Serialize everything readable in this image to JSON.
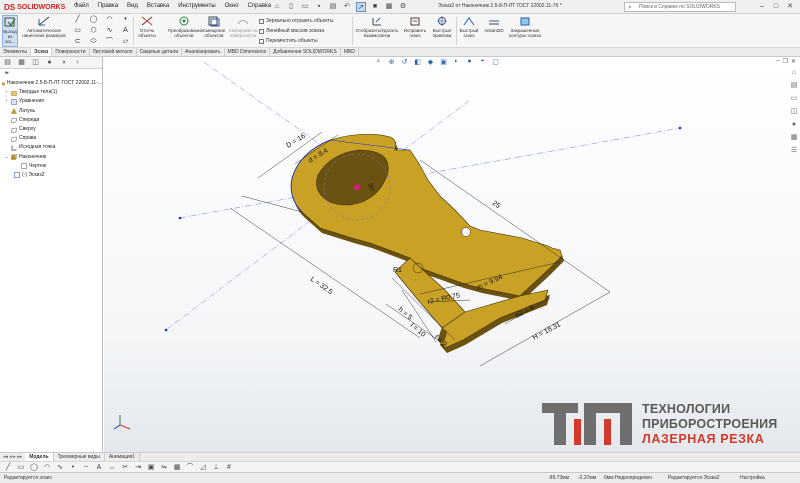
{
  "app": {
    "brand": "SOLIDWORKS",
    "logo_mark": "DS"
  },
  "menu": [
    "Файл",
    "Правка",
    "Вид",
    "Вставка",
    "Инструменты",
    "Окно",
    "Справка"
  ],
  "window": {
    "title": "Эскиз2 от Наконечник 2.5-8-П-ЛТ ГОСТ 22002.11-76 *",
    "search_placeholder": "Поиск в Справке по SOLIDWORKS"
  },
  "ribbon": {
    "exit_sketch": "Выход из эск...",
    "smart_dimension": "Автоматическое нанесение размеров",
    "trim": "Отсечь объекты",
    "convert": "Преобразование объектов",
    "offset": "Смещение объектов",
    "offset_surface": "Смещение на поверхности",
    "mirror": "Зеркально отразить объекты",
    "linear_pattern": "Линейный массив эскиза",
    "move": "Переместить объекты",
    "display_delete": "Отобразить/Удалить взаимосвязи",
    "repair": "Исправить эскиз",
    "quick_snaps": "Быстрые привязки",
    "rapid_sketch": "Быстрый эскиз",
    "instant2d": "Instant2D",
    "shaded_contours": "Закрашенные контуры эскиза"
  },
  "tabs": [
    "Элементы",
    "Эскиз",
    "Поверхности",
    "Листовой металл",
    "Сварные детали",
    "Анализировать",
    "MBD Dimensions",
    "Добавления SOLIDWORKS",
    "MBD"
  ],
  "active_tab": "Эскиз",
  "tree": [
    {
      "label": "Наконечник 2.5-8-П-ЛТ ГОСТ 22002.11-..."
    },
    {
      "label": "Твердые тела(1)"
    },
    {
      "label": "Уравнения"
    },
    {
      "label": "Латунь"
    },
    {
      "label": "Спереди"
    },
    {
      "label": "Сверху"
    },
    {
      "label": "Справа"
    },
    {
      "label": "Исходная точка"
    },
    {
      "label": "Наконечник"
    },
    {
      "label": "Чертеж"
    },
    {
      "label": "(-) Эскиз2"
    }
  ],
  "dimensions": {
    "d_outer": "D = 16",
    "d_inner": "d = 8.4",
    "angle": "30°",
    "length_25": "25",
    "length_total": "L = 32.5",
    "r1": "R1",
    "r2": "r2 = R0.75",
    "m": "m = 9.94",
    "b2": "b2 = 8",
    "h": "h = 5",
    "l": "l = 10",
    "f": "f = 2",
    "hh": "Н = 18.31"
  },
  "watermark": {
    "line1": "ТЕХНОЛОГИИ",
    "line2": "ПРИБОРОСТРОЕНИЯ",
    "line3": "ЛАЗЕРНАЯ РЕЗКА"
  },
  "bottom_tabs": [
    "Модель",
    "Трехмерные виды",
    "Анимация1"
  ],
  "active_bottom_tab": "Модель",
  "status": {
    "left": "Редактируется эскиз",
    "x": "-99.73мм",
    "y": "-2.37мм",
    "z": "0мм Недоопределен",
    "editing": "Редактируется Эскиз2",
    "custom": "Настройка"
  },
  "colors": {
    "part_face": "#c9a225",
    "part_edge": "#7b5f0f",
    "sketch": "#1d2fd6",
    "watermark_red": "#d23a2c",
    "watermark_gray": "#5a5a5a"
  }
}
